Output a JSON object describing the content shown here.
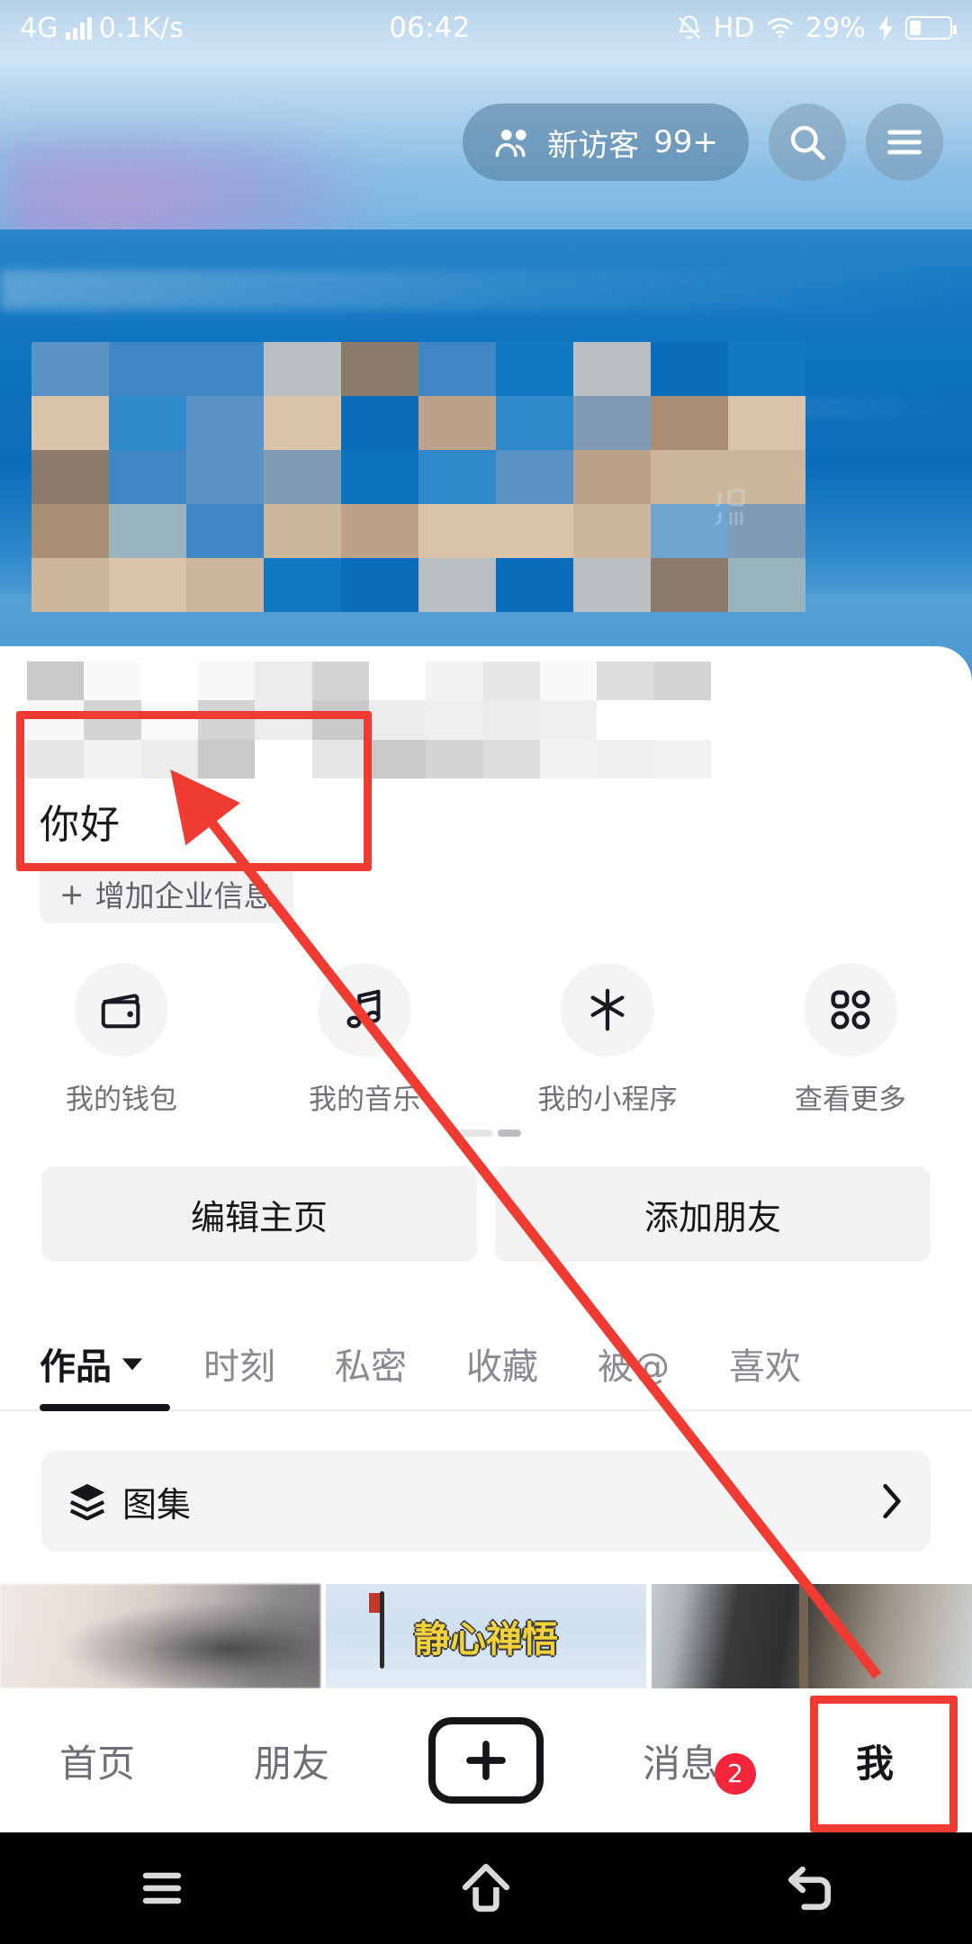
{
  "status_bar": {
    "network_type": "4G",
    "data_rate": "0.1K/s",
    "time": "06:42",
    "hd_label": "HD",
    "battery_percent": "29%",
    "icons": [
      "signal-bars-icon",
      "bell-muted-icon",
      "hd-icon",
      "wifi-icon",
      "charging-bolt-icon",
      "battery-icon"
    ]
  },
  "top_nav": {
    "visitor_pill": {
      "icon": "people-icon",
      "label": "新访客",
      "count": "99+"
    },
    "search_button": {
      "icon": "search-icon"
    },
    "menu_button": {
      "icon": "hamburger-menu-icon"
    }
  },
  "cover": {
    "watermark_icon": "douyin-watermark-icon"
  },
  "profile": {
    "nickname": "你好",
    "business_button": {
      "plus": "+",
      "label": "增加企业信息"
    }
  },
  "quick_actions": [
    {
      "icon": "wallet-icon",
      "label": "我的钱包"
    },
    {
      "icon": "music-note-icon",
      "label": "我的音乐"
    },
    {
      "icon": "mini-program-icon",
      "label": "我的小程序"
    },
    {
      "icon": "grid-apps-icon",
      "label": "查看更多"
    }
  ],
  "action_buttons": [
    {
      "label": "编辑主页"
    },
    {
      "label": "添加朋友"
    }
  ],
  "content_tabs": [
    {
      "label": "作品",
      "active": true,
      "has_caret": true
    },
    {
      "label": "时刻",
      "active": false,
      "has_caret": false
    },
    {
      "label": "私密",
      "active": false,
      "has_caret": false
    },
    {
      "label": "收藏",
      "active": false,
      "has_caret": false
    },
    {
      "label": "被@",
      "active": false,
      "has_caret": false
    },
    {
      "label": "喜欢",
      "active": false,
      "has_caret": false
    }
  ],
  "album_row": {
    "icon": "layers-icon",
    "label": "图集",
    "chevron": "chevron-right-icon"
  },
  "video_grid": [
    {
      "name": "thumbnail-blurry-landscape"
    },
    {
      "name": "thumbnail-calligraphy",
      "text": "静心禅悟"
    },
    {
      "name": "thumbnail-man-outdoors"
    }
  ],
  "bottom_nav": [
    {
      "label": "首页",
      "active": false,
      "badge": ""
    },
    {
      "label": "朋友",
      "active": false,
      "badge": ""
    },
    {
      "label": "",
      "active": false,
      "badge": "",
      "is_plus": true
    },
    {
      "label": "消息",
      "active": false,
      "badge": "2"
    },
    {
      "label": "我",
      "active": true,
      "badge": ""
    }
  ],
  "android_nav": [
    {
      "icon": "recents-icon"
    },
    {
      "icon": "home-icon"
    },
    {
      "icon": "back-icon"
    }
  ],
  "annotations": {
    "highlight_color": "#f03b32",
    "boxes": [
      "nickname-region",
      "me-tab-region"
    ],
    "arrow": "points from me-tab to nickname"
  },
  "colors": {
    "accent_red": "#f03b32",
    "badge_red": "#f5253d",
    "cover_blue": "#0d72bf",
    "card_bg": "#ffffff",
    "chip_bg": "#f2f2f3",
    "text_primary": "#16161a",
    "text_secondary": "#707078"
  }
}
